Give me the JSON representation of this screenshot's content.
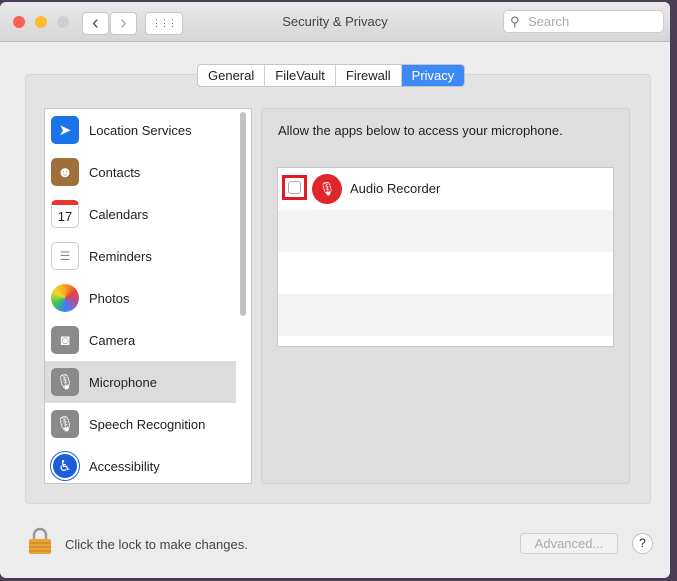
{
  "window": {
    "title": "Security & Privacy"
  },
  "toolbar": {
    "back": "‹",
    "forward": "›",
    "grid": "⋮⋮⋮",
    "search_placeholder": "Search"
  },
  "tabs": [
    {
      "label": "General"
    },
    {
      "label": "FileVault"
    },
    {
      "label": "Firewall"
    },
    {
      "label": "Privacy",
      "selected": true
    }
  ],
  "sidebar": {
    "items": [
      {
        "label": "Location Services",
        "icon": "location-arrow-icon",
        "color": "#1a73e8"
      },
      {
        "label": "Contacts",
        "icon": "contacts-book-icon",
        "color": "#a0703c"
      },
      {
        "label": "Calendars",
        "icon": "calendar-icon",
        "color": "#ffffff",
        "day": "17"
      },
      {
        "label": "Reminders",
        "icon": "reminders-list-icon",
        "color": "#ffffff"
      },
      {
        "label": "Photos",
        "icon": "photos-flower-icon",
        "color": "#f5a623"
      },
      {
        "label": "Camera",
        "icon": "camera-icon",
        "color": "#777777"
      },
      {
        "label": "Microphone",
        "icon": "microphone-icon",
        "color": "#777777",
        "selected": true
      },
      {
        "label": "Speech Recognition",
        "icon": "microphone-icon",
        "color": "#777777"
      },
      {
        "label": "Accessibility",
        "icon": "accessibility-icon",
        "color": "#1a5fd8"
      }
    ]
  },
  "main": {
    "message": "Allow the apps below to access your microphone.",
    "apps": [
      {
        "name": "Audio Recorder",
        "checked": false
      }
    ]
  },
  "footer": {
    "lock_text": "Click the lock to make changes.",
    "advanced_label": "Advanced...",
    "help_label": "?"
  }
}
